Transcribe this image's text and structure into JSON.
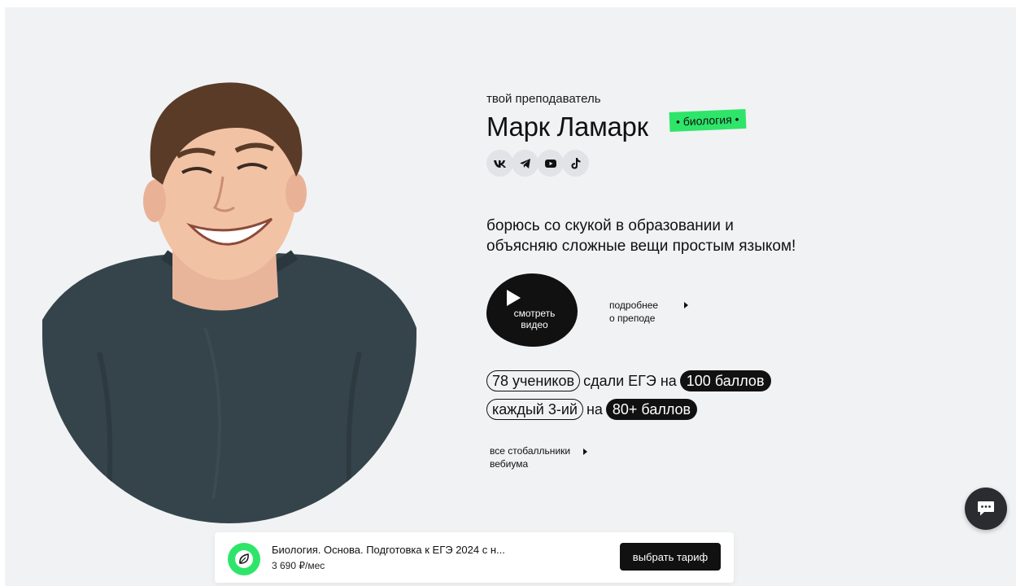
{
  "teacher": {
    "intro": "твой преподаватель",
    "name": "Марк Ламарк",
    "subject": "• биология •",
    "photo_alt": "teacher-photo"
  },
  "socials": [
    {
      "icon": "vk-icon"
    },
    {
      "icon": "telegram-icon"
    },
    {
      "icon": "youtube-icon"
    },
    {
      "icon": "tiktok-icon"
    }
  ],
  "tagline": {
    "line1": "борюсь со скукой в образовании и",
    "line2": "объясняю сложные вещи простым языком!"
  },
  "video": {
    "line1": "смотреть",
    "line2": "видео"
  },
  "more": {
    "line1": "подробнее",
    "line2": "о преподе"
  },
  "stats": {
    "students": "78 учеников",
    "passed": "сдали ЕГЭ на",
    "score100": "100 баллов",
    "every": "каждый 3-ий",
    "on": "на",
    "score80": "80+ баллов"
  },
  "all_link": {
    "line1": "все стобалльники",
    "line2": "вебиума"
  },
  "bottom_bar": {
    "course_title": "Биология. Основа. Подготовка к ЕГЭ 2024 с н...",
    "price": "3 690 ₽/мес",
    "button": "выбрать тариф"
  },
  "colors": {
    "accent_green": "#2ee56a",
    "dark": "#111111",
    "background": "#f1f2f4"
  }
}
